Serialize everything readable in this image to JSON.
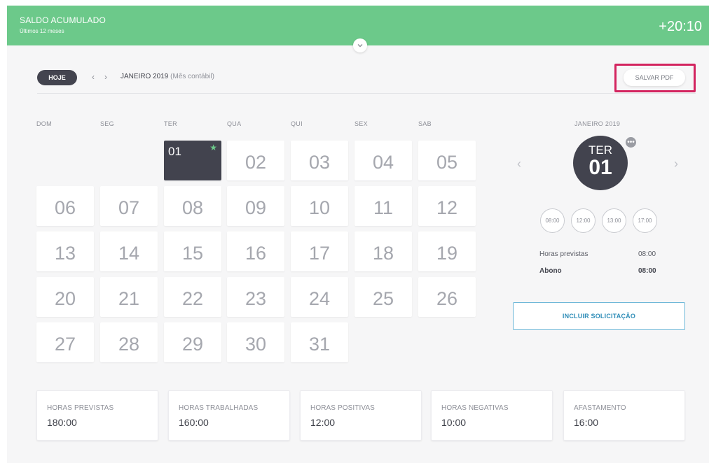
{
  "header": {
    "title": "SALDO ACUMULADO",
    "subtitle": "Últimos 12 meses",
    "balance": "+20:10",
    "toggle_icon": "chevron-down-icon"
  },
  "toolbar": {
    "today_label": "HOJE",
    "prev_icon": "‹",
    "next_icon": "›",
    "month": "JANEIRO 2019",
    "month_note": "(Mês contábil)",
    "pdf_label": "SALVAR PDF",
    "highlight_color": "#d3245f"
  },
  "calendar": {
    "weekdays": [
      "DOM",
      "SEG",
      "TER",
      "QUA",
      "QUI",
      "SEX",
      "SAB"
    ],
    "days": [
      "01",
      "02",
      "03",
      "04",
      "05",
      "06",
      "07",
      "08",
      "09",
      "10",
      "11",
      "12",
      "13",
      "14",
      "15",
      "16",
      "17",
      "18",
      "19",
      "20",
      "21",
      "22",
      "23",
      "24",
      "25",
      "26",
      "27",
      "28",
      "29",
      "30",
      "31"
    ],
    "selected_day": "01",
    "selected_marker": "★"
  },
  "detail": {
    "month": "JANEIRO 2019",
    "weekday": "TER",
    "day": "01",
    "prev_icon": "‹",
    "next_icon": "›",
    "more_icon": "•••",
    "times": [
      "08:00",
      "12:00",
      "13:00",
      "17:00"
    ],
    "rows": [
      {
        "label": "Horas previstas",
        "value": "08:00"
      },
      {
        "label": "Abono",
        "value": "08:00"
      }
    ],
    "action_label": "INCLUIR SOLICITAÇÃO"
  },
  "summary": [
    {
      "label": "HORAS PREVISTAS",
      "value": "180:00"
    },
    {
      "label": "HORAS TRABALHADAS",
      "value": "160:00"
    },
    {
      "label": "HORAS POSITIVAS",
      "value": "12:00"
    },
    {
      "label": "HORAS NEGATIVAS",
      "value": "10:00"
    },
    {
      "label": "AFASTAMENTO",
      "value": "16:00"
    }
  ],
  "colors": {
    "header_green": "#6cc98a",
    "dark": "#42434e",
    "action_blue": "#2f8db8"
  }
}
